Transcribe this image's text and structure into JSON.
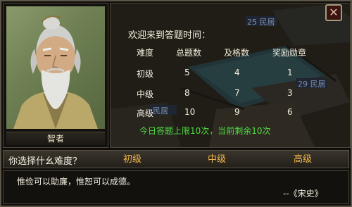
{
  "character": {
    "name": "智者"
  },
  "dialog": {
    "welcome": "欢迎来到答题时间：",
    "headers": [
      "难度",
      "总题数",
      "及格数",
      "奖励勋章"
    ],
    "rows": [
      {
        "level": "初级",
        "total": "5",
        "pass": "4",
        "medals": "1"
      },
      {
        "level": "中级",
        "total": "8",
        "pass": "7",
        "medals": "3"
      },
      {
        "level": "高级",
        "total": "10",
        "pass": "9",
        "medals": "6"
      }
    ],
    "quota": "今日答题上限10次，当前剩余10次"
  },
  "scene": {
    "signs": [
      "25 民居",
      "29 民居",
      "民居"
    ]
  },
  "question": {
    "prompt": "你选择什幺难度？",
    "options": [
      "初级",
      "中级",
      "高级"
    ]
  },
  "quote": {
    "text": "惟俭可以助廉，惟恕可以成德。",
    "source": "--《宋史》"
  },
  "close": {
    "symbol": "✕"
  },
  "colors": {
    "accent": "#f0b64b",
    "quota": "#4fdc43",
    "text": "#f2eede"
  }
}
